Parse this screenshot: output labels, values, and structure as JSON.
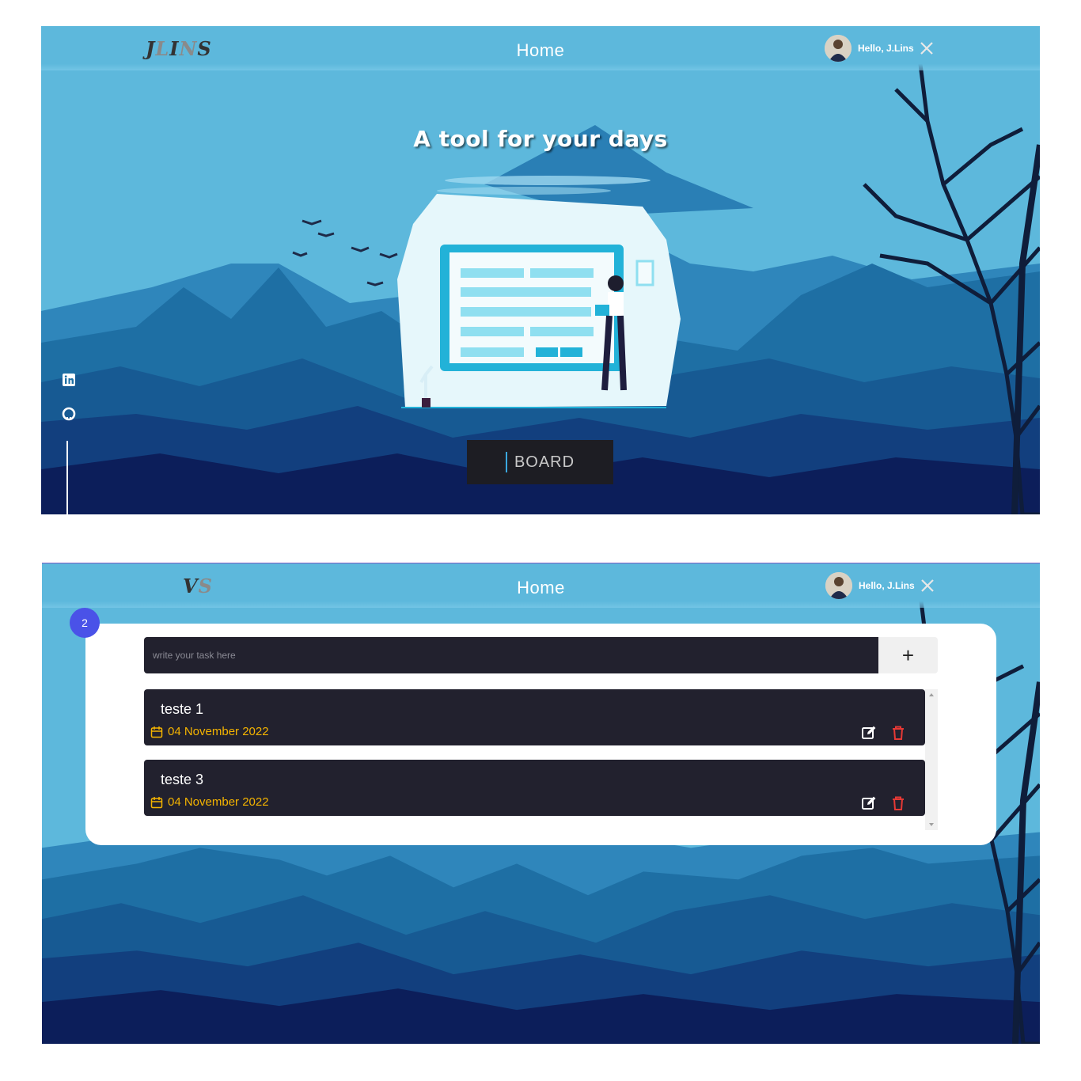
{
  "nav": {
    "title": "Home",
    "logo_full": {
      "a": "J",
      "b": "L",
      "c": "I",
      "d": "N",
      "e": "S"
    },
    "logo_partial": {
      "a": "V",
      "b": "S"
    },
    "user_greeting": "Hello, J.Lins"
  },
  "hero": {
    "title": "A tool for your days",
    "board_button": "BOARD"
  },
  "social": [
    "linkedin-icon",
    "github-icon"
  ],
  "board": {
    "task_count": "2",
    "input_placeholder": "write your task here",
    "add_label": "+",
    "tasks": [
      {
        "title": "teste 1",
        "date": "04 November 2022"
      },
      {
        "title": "teste 3",
        "date": "04 November 2022"
      }
    ]
  },
  "colors": {
    "sky": "#5db8dc",
    "task_bg": "#22212e",
    "date": "#f5b400",
    "delete": "#e53935",
    "badge": "#4a52e8"
  }
}
